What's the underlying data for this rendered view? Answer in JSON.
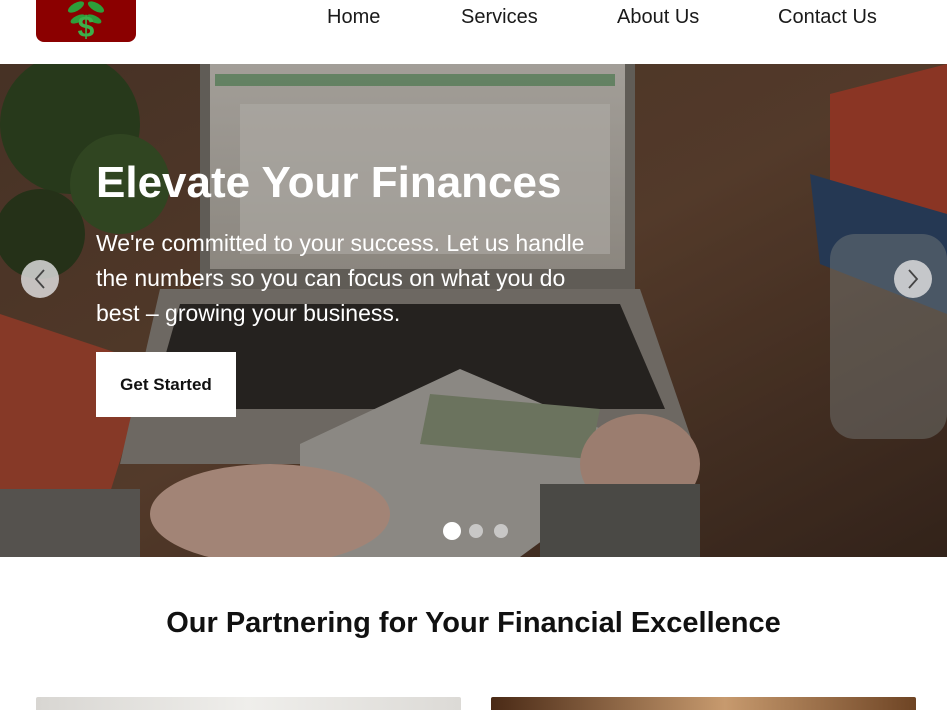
{
  "brand": {
    "logo_symbol": "$",
    "logo_color": "#8b0000",
    "logo_accent": "#2e9e3a"
  },
  "nav": {
    "items": [
      "Home",
      "Services",
      "About Us",
      "Contact Us"
    ]
  },
  "hero": {
    "title": "Elevate Your Finances",
    "subtitle": "We're committed to your success. Let us handle the numbers so you can focus on what you do best – growing your business.",
    "cta_label": "Get Started",
    "prev_icon": "chevron-left-icon",
    "next_icon": "chevron-right-icon",
    "slide_count": 3,
    "active_slide": 1
  },
  "section": {
    "title": "Our Partnering for Your Financial Excellence"
  }
}
